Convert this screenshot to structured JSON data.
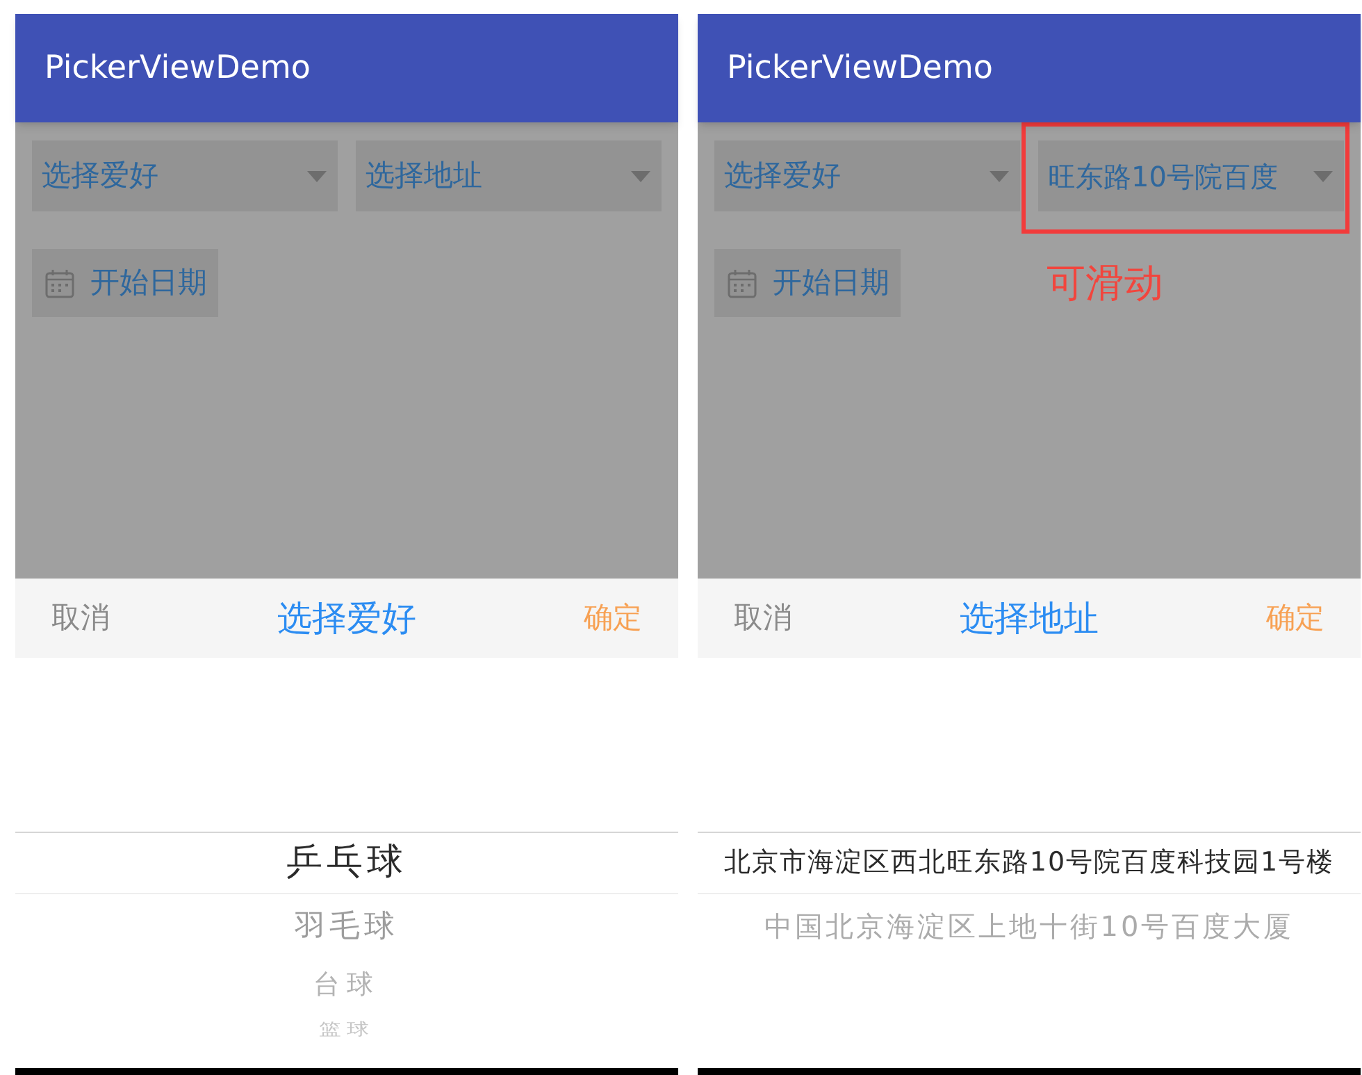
{
  "screens": [
    {
      "app_bar": {
        "title": "PickerViewDemo"
      },
      "spinners": [
        {
          "value": "选择爱好",
          "highlighted": false
        },
        {
          "value": "选择地址",
          "highlighted": false
        }
      ],
      "date_button": {
        "label": "开始日期"
      },
      "picker": {
        "cancel": "取消",
        "title": "选择爱好",
        "confirm": "确定",
        "options": [
          {
            "label": "乒乓球",
            "selected": true
          },
          {
            "label": "羽毛球",
            "selected": false
          },
          {
            "label": "台球",
            "selected": false
          },
          {
            "label": "篮球",
            "selected": false
          }
        ]
      }
    },
    {
      "app_bar": {
        "title": "PickerViewDemo"
      },
      "spinners": [
        {
          "value": "选择爱好",
          "highlighted": false
        },
        {
          "value": "旺东路10号院百度",
          "highlighted": true
        }
      ],
      "date_button": {
        "label": "开始日期"
      },
      "annotation": {
        "text": "可滑动"
      },
      "picker": {
        "cancel": "取消",
        "title": "选择地址",
        "confirm": "确定",
        "options": [
          {
            "label": "北京市海淀区西北旺东路10号院百度科技园1号楼",
            "selected": true
          },
          {
            "label": "中国北京海淀区上地十街10号百度大厦",
            "selected": false
          }
        ]
      }
    }
  ]
}
